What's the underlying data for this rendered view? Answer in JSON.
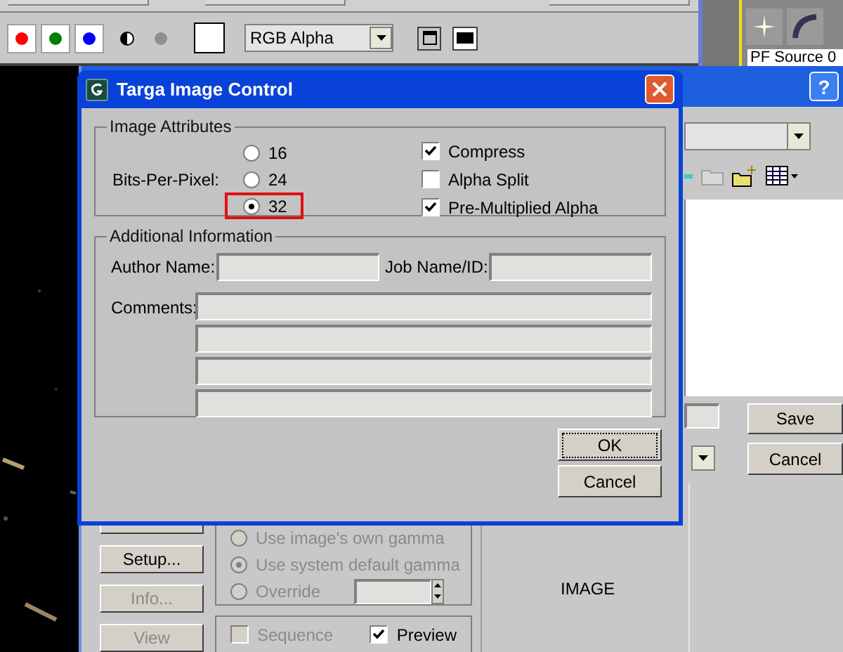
{
  "toolbar": {
    "channel_buttons": [
      {
        "color": "#ff0000"
      },
      {
        "color": "#008000"
      },
      {
        "color": "#0000ff"
      }
    ],
    "channel_select": {
      "value": "RGB Alpha"
    }
  },
  "side_panel": {
    "label": "PF Source 0"
  },
  "file_dialog": {
    "help": "?",
    "buttons": [
      "Save",
      "Cancel"
    ],
    "side_buttons": [
      {
        "label": "Setup...",
        "disabled": false
      },
      {
        "label": "Info...",
        "disabled": true
      },
      {
        "label": "View",
        "disabled": true
      }
    ],
    "gamma": [
      {
        "label": "Use image's own gamma",
        "selected": false
      },
      {
        "label": "Use system default gamma",
        "selected": true
      },
      {
        "label": "Override",
        "selected": false
      }
    ],
    "sequence": {
      "label": "Sequence",
      "checked": false
    },
    "preview": {
      "label": "Preview",
      "checked": true
    },
    "image_label": "IMAGE"
  },
  "dialog": {
    "title": "Targa Image Control",
    "attributes_group": "Image Attributes",
    "bits_label": "Bits-Per-Pixel:",
    "bits_options": [
      {
        "label": "16",
        "selected": false,
        "highlighted": false
      },
      {
        "label": "24",
        "selected": false,
        "highlighted": false
      },
      {
        "label": "32",
        "selected": true,
        "highlighted": true
      }
    ],
    "options": [
      {
        "label": "Compress",
        "checked": true
      },
      {
        "label": "Alpha Split",
        "checked": false
      },
      {
        "label": "Pre-Multiplied Alpha",
        "checked": true
      }
    ],
    "info_group": "Additional Information",
    "author_label": "Author Name:",
    "job_label": "Job Name/ID:",
    "comments_label": "Comments:",
    "buttons": [
      {
        "label": "OK",
        "focused": true
      },
      {
        "label": "Cancel",
        "focused": false
      }
    ]
  }
}
